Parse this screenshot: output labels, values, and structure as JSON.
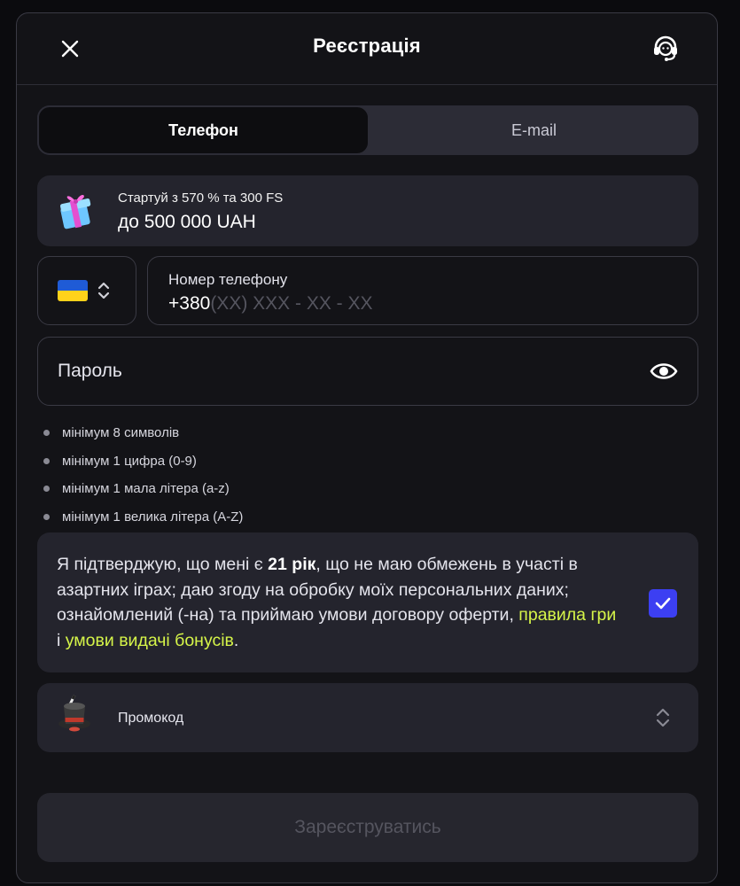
{
  "header": {
    "title": "Реєстрація"
  },
  "tabs": [
    {
      "label": "Телефон",
      "active": true
    },
    {
      "label": "E-mail",
      "active": false
    }
  ],
  "bonus": {
    "line1": "Стартуй з 570 % та 300 FS",
    "line2": "до 500 000 UAH",
    "icon": "gift-icon"
  },
  "phone": {
    "country_flag": "ukraine-flag",
    "label": "Номер телефону",
    "prefix": "+380",
    "mask": "(XX) XXX - XX - XX"
  },
  "password": {
    "placeholder": "Пароль"
  },
  "password_rules": [
    "мінімум 8 символів",
    "мінімум 1 цифра (0-9)",
    "мінімум 1 мала літера (a-z)",
    "мінімум 1 велика літера (A-Z)"
  ],
  "consent": {
    "part1": "Я підтверджую, що мені є ",
    "age": "21 рік",
    "part2": ", що не маю обмежень в участі в азартних іграх; даю згоду на обробку моїх персональних даних; ознайомлений (-на) та приймаю умови договору оферти, ",
    "link1": "правила гри",
    "between": " і ",
    "link2": "умови видачі бонусів",
    "end": ".",
    "checked": true
  },
  "promo": {
    "label": "Промокод"
  },
  "submit": {
    "label": "Зареєструватись"
  },
  "colors": {
    "accent_link": "#d6f549",
    "checkbox": "#3c3ff2",
    "flag_blue": "#1f5bd6",
    "flag_yellow": "#ffd21a"
  }
}
